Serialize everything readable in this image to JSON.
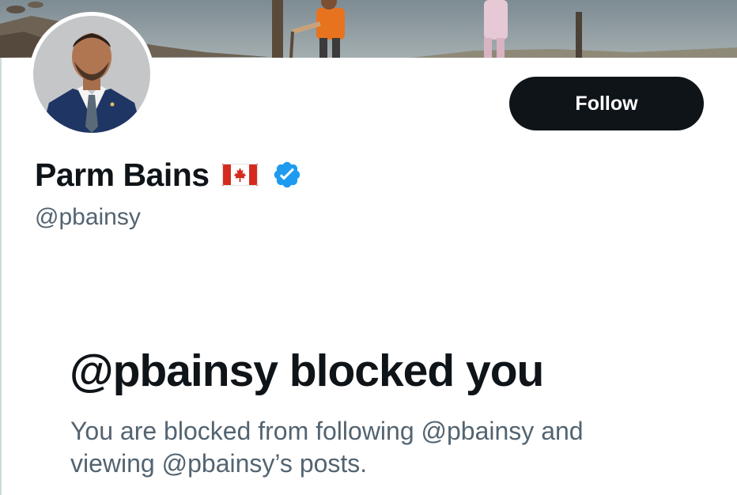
{
  "profile": {
    "display_name": "Parm Bains",
    "handle": "@pbainsy",
    "flag_icon": "canada-flag-icon",
    "verified_icon": "verified-badge-icon",
    "verified_color": "#1d9bf0",
    "banner_image": "lakeshore-children-photo",
    "avatar_image": "man-in-suit-portrait"
  },
  "actions": {
    "follow_label": "Follow"
  },
  "blocked_notice": {
    "title": "@pbainsy blocked you",
    "description": "You are blocked from following @pbainsy and viewing @pbainsy’s posts."
  },
  "colors": {
    "primary_text": "#0f1419",
    "secondary_text": "#536471",
    "button_bg": "#0f1419",
    "button_text": "#ffffff"
  }
}
